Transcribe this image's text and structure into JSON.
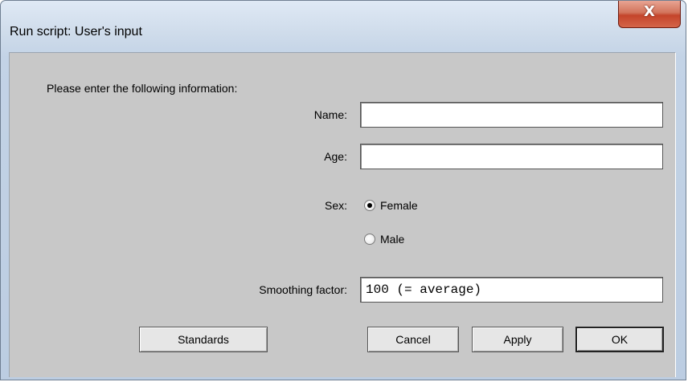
{
  "window": {
    "title": "Run script: User's input",
    "close_glyph": "X"
  },
  "form": {
    "prompt": "Please enter the following information:",
    "name": {
      "label": "Name:",
      "value": ""
    },
    "age": {
      "label": "Age:",
      "value": ""
    },
    "sex": {
      "label": "Sex:",
      "options": [
        {
          "label": "Female",
          "checked": true
        },
        {
          "label": "Male",
          "checked": false
        }
      ]
    },
    "smoothing": {
      "label": "Smoothing factor:",
      "value": "100 (= average)"
    }
  },
  "buttons": {
    "standards": "Standards",
    "cancel": "Cancel",
    "apply": "Apply",
    "ok": "OK"
  },
  "colors": {
    "client_bg": "#c8c8c8",
    "close_button": "#c4442a"
  }
}
